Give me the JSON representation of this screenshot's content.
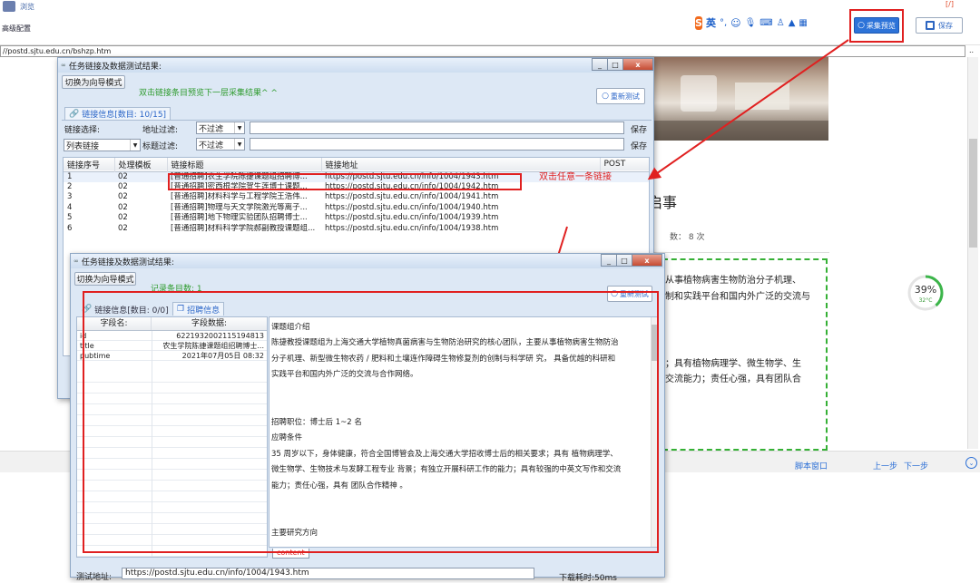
{
  "app": {
    "menu_browse": "浏览",
    "advanced_config": "高级配置",
    "capture_preview": "采集预览",
    "save": "保存",
    "red_corner": "[/]",
    "url": "//postd.sjtu.edu.cn/bshzp.htm",
    "url_more": "..",
    "ime_label": "英",
    "script_window": "脚本窗口",
    "prev_step": "上一步",
    "next_step": "下一步"
  },
  "browser_page": {
    "heading_fragment": "启事",
    "views_fragment": "数： 8 次",
    "right_text_1": "从事植物病害生物防治分子机理、",
    "right_text_2": "制和实践平台和国内外广泛的交流与",
    "right_text_3": "；具有植物病理学、微生物学、生",
    "right_text_4": "交流能力；责任心强，具有团队合",
    "gauge_value": 39,
    "gauge_percent": "39%",
    "gauge_temp": "32°C"
  },
  "win1": {
    "title": "任务链接及数据测试结果:",
    "switch_mode": "切换为向导模式",
    "hint": "双击链接条目预览下一层采集结果^ ^",
    "retest": "重新测试",
    "link_info_tab": "链接信息[数目: 10/15]",
    "link_select_label": "链接选择:",
    "addr_filter_label": "地址过滤:",
    "no_filter": "不过滤",
    "save": "保存",
    "list_link": "列表链接",
    "title_filter_label": "标题过滤:",
    "columns": [
      "链接序号",
      "处理模板",
      "链接标题",
      "链接地址",
      "POST"
    ],
    "rows": [
      [
        "1",
        "02",
        "[普通招聘]农生学院陈捷课题组招聘博...",
        "https://postd.sjtu.edu.cn/info/1004/1943.htm",
        ""
      ],
      [
        "2",
        "02",
        "[普通招聘]密西根学院贺生莲博士课题...",
        "https://postd.sjtu.edu.cn/info/1004/1942.htm",
        ""
      ],
      [
        "3",
        "02",
        "[普通招聘]材料科学与工程学院王浩伟...",
        "https://postd.sjtu.edu.cn/info/1004/1941.htm",
        ""
      ],
      [
        "4",
        "02",
        "[普通招聘]物理与天文学院激光等离子...",
        "https://postd.sjtu.edu.cn/info/1004/1940.htm",
        ""
      ],
      [
        "5",
        "02",
        "[普通招聘]地下物理实验团队招聘博士...",
        "https://postd.sjtu.edu.cn/info/1004/1939.htm",
        ""
      ],
      [
        "6",
        "02",
        "[普通招聘]材料科学学院郝副教授课题组...",
        "https://postd.sjtu.edu.cn/info/1004/1938.htm",
        ""
      ]
    ],
    "annotation": "双击任意一条链接"
  },
  "win2": {
    "title": "任务链接及数据测试结果:",
    "switch_mode": "切换为向导模式",
    "record_count": "记录条目数: 1",
    "retest": "重新测试",
    "link_info_tab": "链接信息[数目: 0/0]",
    "recruit_tab": "招聘信息",
    "field_name_header": "字段名:",
    "field_data_header": "字段数据:",
    "fields": [
      [
        "id",
        "6221932002115194813"
      ],
      [
        "title",
        "农生学院陈捷课题组招聘博士..."
      ],
      [
        "pubtime",
        "2021年07月05日 08:32"
      ]
    ],
    "content_title": "课题组介绍",
    "content_lines": [
      "陈捷教授课题组为上海交通大学植物真菌病害与生物防治研究的核心团队，主要从事植物病害生物防治",
      "分子机理、新型微生物农药 / 肥料和土壤连作障碍生物修复剂的创制与科学研 究， 具备优越的科研和",
      "实践平台和国内外广泛的交流与合作网络。",
      "",
      "",
      "招聘职位：博士后 1~2 名",
      "应聘条件",
      "35 周岁以下，身体健康，符合全国博管会及上海交通大学招收博士后的相关要求；具有 植物病理学、",
      "微生物学、生物技术与发酵工程专业 背景；有独立开展科研工作的能力；具有较强的中英文写作和交流",
      "能力；责任心强，具有 团队合作精神 。",
      "",
      "",
      "主要研究方向"
    ],
    "content_tab": "content",
    "test_addr_label": "测试地址:",
    "test_addr": "https://postd.sjtu.edu.cn/info/1004/1943.htm",
    "download_text": "下载耗时:50ms"
  },
  "colors": {
    "annotation_red": "#e02020",
    "accent_blue": "#1a66d6",
    "hint_green": "#2e9b2e"
  }
}
